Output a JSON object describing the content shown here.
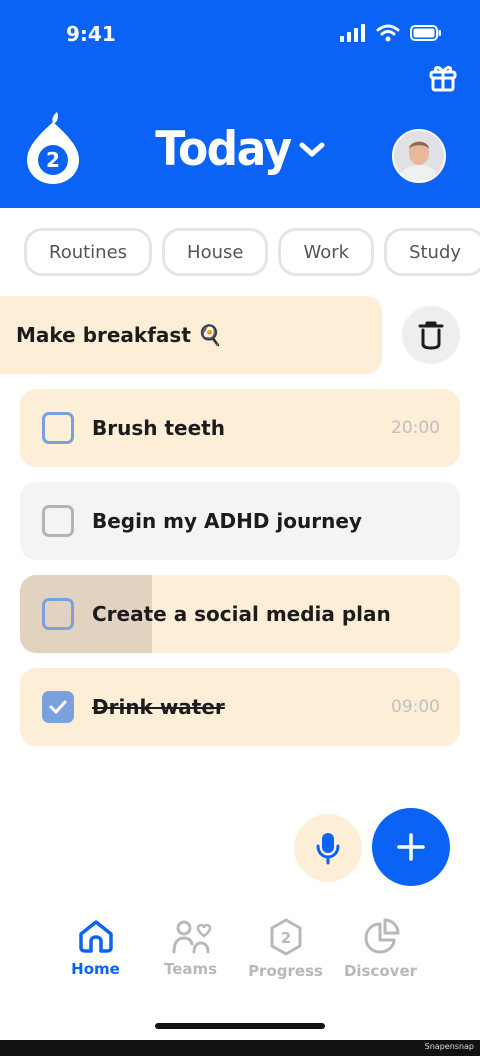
{
  "status_bar": {
    "time": "9:41"
  },
  "header": {
    "title": "Today",
    "logo_number": "2"
  },
  "chips": [
    "Routines",
    "House",
    "Work",
    "Study"
  ],
  "swiped_task": {
    "label": "Make breakfast 🍳"
  },
  "tasks": [
    {
      "label": "Brush teeth",
      "time": "20:00",
      "done": false
    },
    {
      "label": "Begin my ADHD journey",
      "time": "",
      "done": false
    },
    {
      "label": "Create a social media plan",
      "time": "",
      "done": false
    },
    {
      "label": "Drink water",
      "time": "09:00",
      "done": true
    }
  ],
  "nav": {
    "items": [
      {
        "label": "Home",
        "icon": "home-icon",
        "active": true
      },
      {
        "label": "Teams",
        "icon": "teams-icon",
        "active": false
      },
      {
        "label": "Progress",
        "icon": "progress-icon",
        "active": false,
        "number": "2"
      },
      {
        "label": "Discover",
        "icon": "discover-icon",
        "active": false
      }
    ]
  },
  "watermark": "Snapensnap",
  "colors": {
    "primary": "#0a63f5",
    "peach": "#fdeed7",
    "check": "#7ba0de"
  }
}
